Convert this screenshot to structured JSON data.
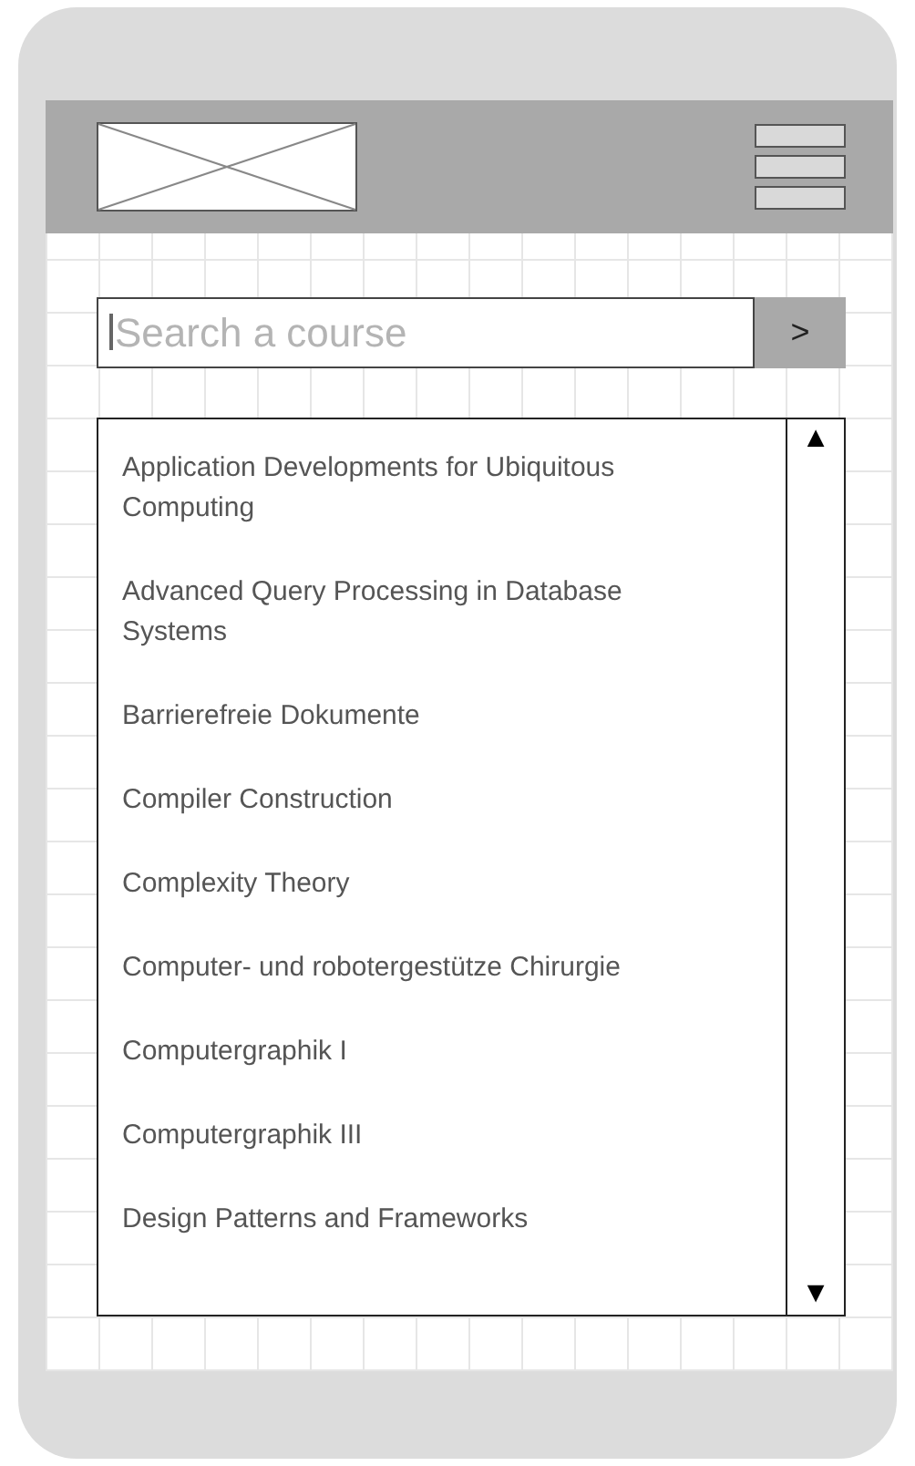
{
  "search": {
    "placeholder": "Search a course",
    "button": ">"
  },
  "courses": [
    {
      "name": "Application Developments for Ubiquitous Computing"
    },
    {
      "name": "Advanced Query Processing in Database Systems"
    },
    {
      "name": "Barrierefreie Dokumente"
    },
    {
      "name": "Compiler Construction"
    },
    {
      "name": "Complexity Theory"
    },
    {
      "name": "Computer- und robotergestütze Chirurgie"
    },
    {
      "name": "Computergraphik I"
    },
    {
      "name": "Computergraphik III"
    },
    {
      "name": "Design Patterns and Frameworks"
    }
  ],
  "scrollbar": {
    "up": "▲",
    "down": "▼"
  }
}
